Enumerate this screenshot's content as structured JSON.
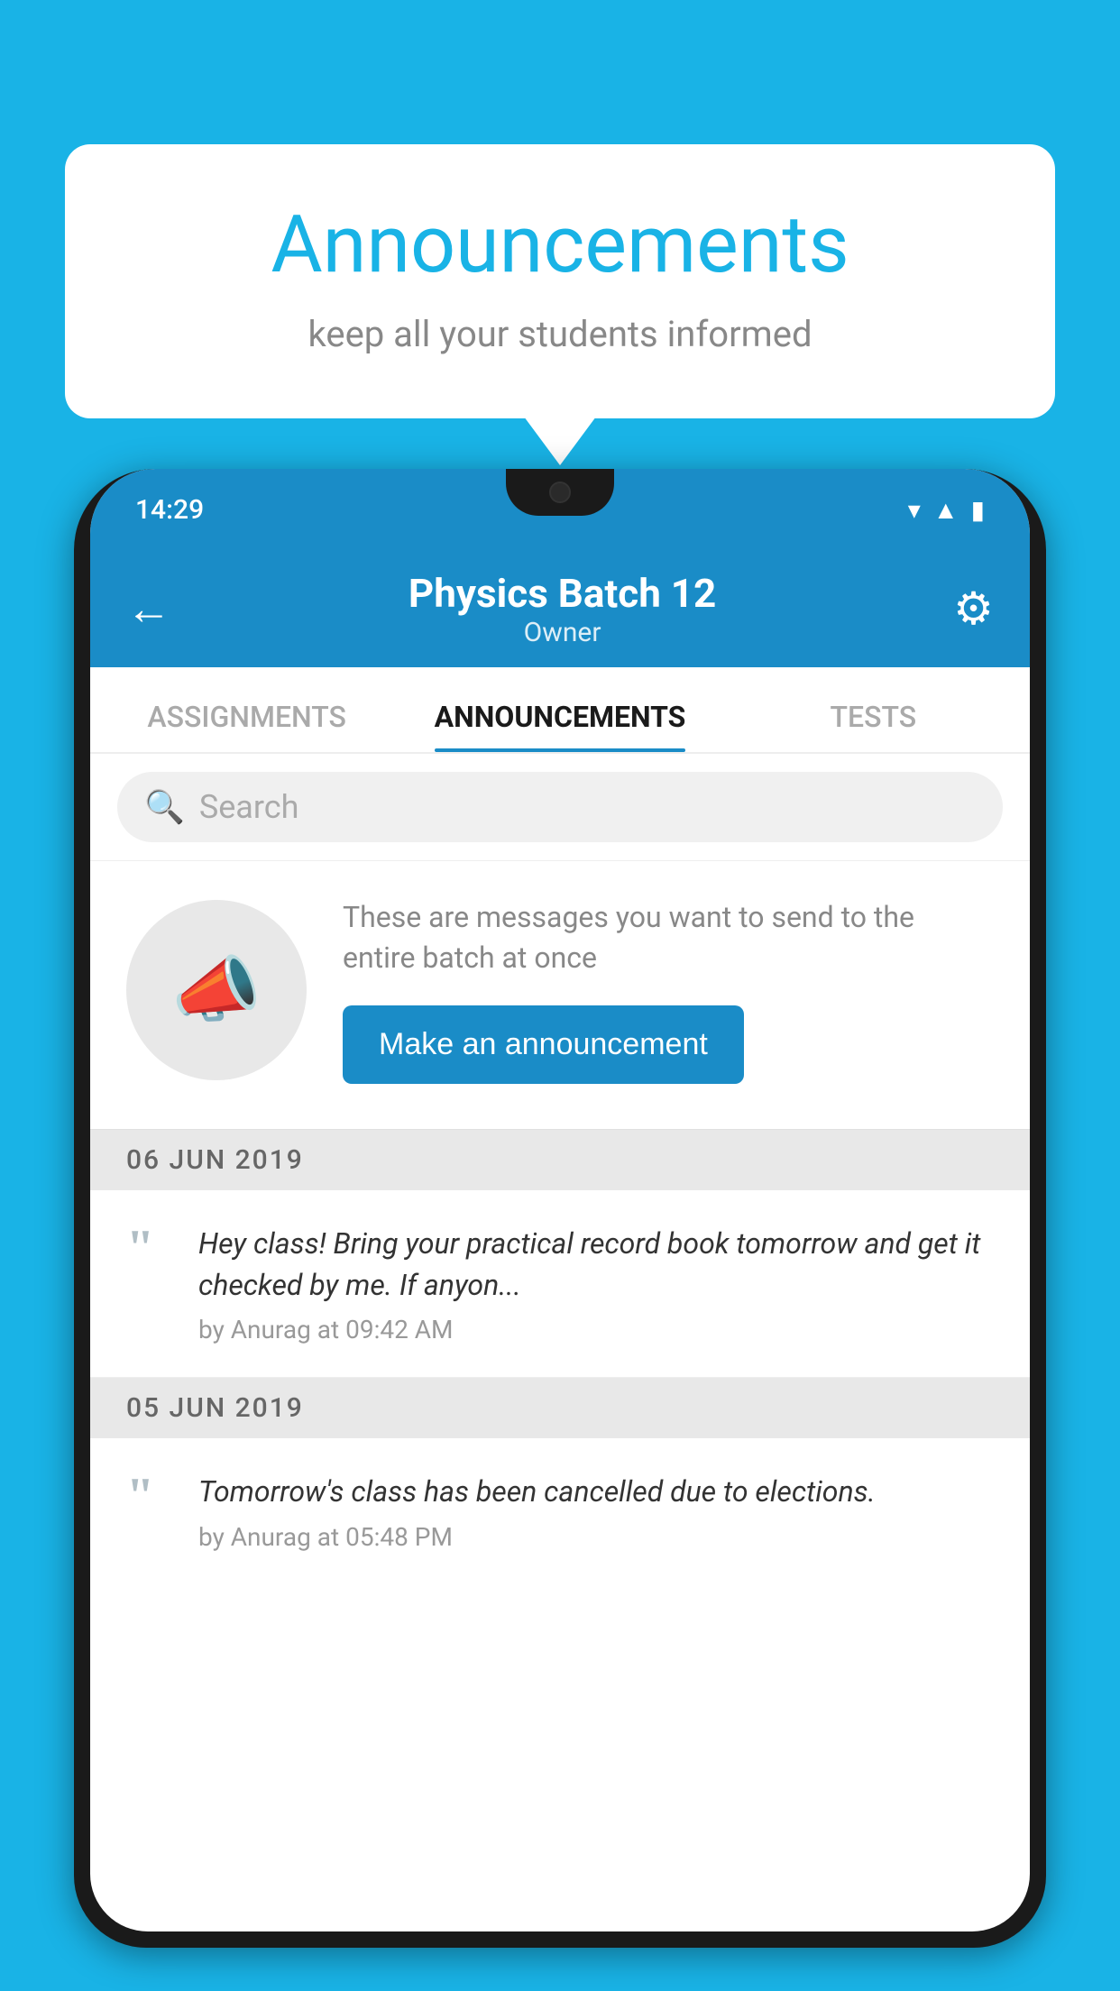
{
  "background_color": "#19b3e6",
  "speech_bubble": {
    "title": "Announcements",
    "subtitle": "keep all your students informed"
  },
  "phone": {
    "status_bar": {
      "time": "14:29",
      "icons": [
        "wifi",
        "signal",
        "battery"
      ]
    },
    "header": {
      "title": "Physics Batch 12",
      "subtitle": "Owner",
      "back_label": "←",
      "gear_label": "⚙"
    },
    "tabs": [
      {
        "label": "ASSIGNMENTS",
        "active": false
      },
      {
        "label": "ANNOUNCEMENTS",
        "active": true
      },
      {
        "label": "TESTS",
        "active": false
      }
    ],
    "search": {
      "placeholder": "Search"
    },
    "promo": {
      "description": "These are messages you want to send to the entire batch at once",
      "button_label": "Make an announcement"
    },
    "announcements": [
      {
        "date": "06  JUN  2019",
        "body": "Hey class! Bring your practical record book tomorrow and get it checked by me. If anyon...",
        "meta": "by Anurag at 09:42 AM"
      },
      {
        "date": "05  JUN  2019",
        "body": "Tomorrow's class has been cancelled due to elections.",
        "meta": "by Anurag at 05:48 PM"
      }
    ]
  }
}
